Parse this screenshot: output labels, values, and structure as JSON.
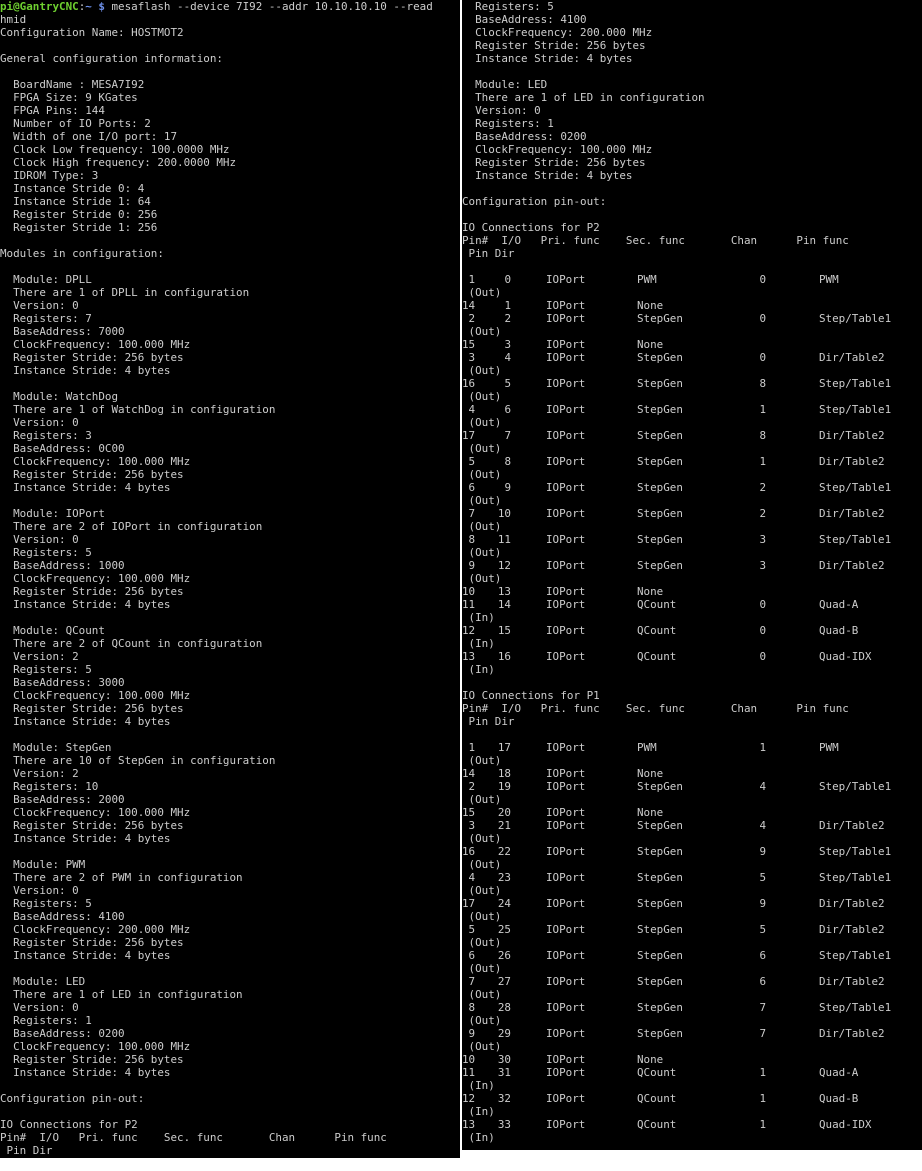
{
  "terminal": {
    "prompt_user": "pi@GantryCNC",
    "prompt_sep": ":",
    "prompt_path": "~ $",
    "command": " mesaflash --device 7I92 --addr 10.10.10.10 --read",
    "command_wrap": "hmid"
  },
  "left_lines": [
    "Configuration Name: HOSTMOT2",
    "",
    "General configuration information:",
    "",
    "  BoardName : MESA7I92",
    "  FPGA Size: 9 KGates",
    "  FPGA Pins: 144",
    "  Number of IO Ports: 2",
    "  Width of one I/O port: 17",
    "  Clock Low frequency: 100.0000 MHz",
    "  Clock High frequency: 200.0000 MHz",
    "  IDROM Type: 3",
    "  Instance Stride 0: 4",
    "  Instance Stride 1: 64",
    "  Register Stride 0: 256",
    "  Register Stride 1: 256",
    "",
    "Modules in configuration:",
    "",
    "  Module: DPLL",
    "  There are 1 of DPLL in configuration",
    "  Version: 0",
    "  Registers: 7",
    "  BaseAddress: 7000",
    "  ClockFrequency: 100.000 MHz",
    "  Register Stride: 256 bytes",
    "  Instance Stride: 4 bytes",
    "",
    "  Module: WatchDog",
    "  There are 1 of WatchDog in configuration",
    "  Version: 0",
    "  Registers: 3",
    "  BaseAddress: 0C00",
    "  ClockFrequency: 100.000 MHz",
    "  Register Stride: 256 bytes",
    "  Instance Stride: 4 bytes",
    "",
    "  Module: IOPort",
    "  There are 2 of IOPort in configuration",
    "  Version: 0",
    "  Registers: 5",
    "  BaseAddress: 1000",
    "  ClockFrequency: 100.000 MHz",
    "  Register Stride: 256 bytes",
    "  Instance Stride: 4 bytes",
    "",
    "  Module: QCount",
    "  There are 2 of QCount in configuration",
    "  Version: 2",
    "  Registers: 5",
    "  BaseAddress: 3000",
    "  ClockFrequency: 100.000 MHz",
    "  Register Stride: 256 bytes",
    "  Instance Stride: 4 bytes",
    "",
    "  Module: StepGen",
    "  There are 10 of StepGen in configuration",
    "  Version: 2",
    "  Registers: 10",
    "  BaseAddress: 2000",
    "  ClockFrequency: 100.000 MHz",
    "  Register Stride: 256 bytes",
    "  Instance Stride: 4 bytes",
    "",
    "  Module: PWM",
    "  There are 2 of PWM in configuration",
    "  Version: 0",
    "  Registers: 5",
    "  BaseAddress: 4100",
    "  ClockFrequency: 200.000 MHz",
    "  Register Stride: 256 bytes",
    "  Instance Stride: 4 bytes",
    "",
    "  Module: LED",
    "  There are 1 of LED in configuration",
    "  Version: 0",
    "  Registers: 1",
    "  BaseAddress: 0200",
    "  ClockFrequency: 100.000 MHz",
    "  Register Stride: 256 bytes",
    "  Instance Stride: 4 bytes",
    "",
    "Configuration pin-out:",
    "",
    "IO Connections for P2",
    "Pin#  I/O   Pri. func    Sec. func       Chan      Pin func",
    " Pin Dir"
  ],
  "right_top_lines": [
    "  Registers: 5",
    "  BaseAddress: 4100",
    "  ClockFrequency: 200.000 MHz",
    "  Register Stride: 256 bytes",
    "  Instance Stride: 4 bytes",
    "",
    "  Module: LED",
    "  There are 1 of LED in configuration",
    "  Version: 0",
    "  Registers: 1",
    "  BaseAddress: 0200",
    "  ClockFrequency: 100.000 MHz",
    "  Register Stride: 256 bytes",
    "  Instance Stride: 4 bytes",
    "",
    "Configuration pin-out:",
    ""
  ],
  "connections": [
    {
      "title": "IO Connections for P2",
      "header": "Pin#  I/O   Pri. func    Sec. func       Chan      Pin func",
      "header2": " Pin Dir",
      "rows": [
        {
          "pin": " 1",
          "io": "0",
          "pri": "IOPort",
          "sec": "PWM",
          "chan": "0",
          "func": "PWM",
          "dir": " (Out)"
        },
        {
          "pin": "14",
          "io": "1",
          "pri": "IOPort",
          "sec": "None",
          "chan": "",
          "func": "",
          "dir": ""
        },
        {
          "pin": " 2",
          "io": "2",
          "pri": "IOPort",
          "sec": "StepGen",
          "chan": "0",
          "func": "Step/Table1",
          "dir": " (Out)"
        },
        {
          "pin": "15",
          "io": "3",
          "pri": "IOPort",
          "sec": "None",
          "chan": "",
          "func": "",
          "dir": ""
        },
        {
          "pin": " 3",
          "io": "4",
          "pri": "IOPort",
          "sec": "StepGen",
          "chan": "0",
          "func": "Dir/Table2",
          "dir": " (Out)"
        },
        {
          "pin": "16",
          "io": "5",
          "pri": "IOPort",
          "sec": "StepGen",
          "chan": "8",
          "func": "Step/Table1",
          "dir": " (Out)"
        },
        {
          "pin": " 4",
          "io": "6",
          "pri": "IOPort",
          "sec": "StepGen",
          "chan": "1",
          "func": "Step/Table1",
          "dir": " (Out)"
        },
        {
          "pin": "17",
          "io": "7",
          "pri": "IOPort",
          "sec": "StepGen",
          "chan": "8",
          "func": "Dir/Table2",
          "dir": " (Out)"
        },
        {
          "pin": " 5",
          "io": "8",
          "pri": "IOPort",
          "sec": "StepGen",
          "chan": "1",
          "func": "Dir/Table2",
          "dir": " (Out)"
        },
        {
          "pin": " 6",
          "io": "9",
          "pri": "IOPort",
          "sec": "StepGen",
          "chan": "2",
          "func": "Step/Table1",
          "dir": " (Out)"
        },
        {
          "pin": " 7",
          "io": "10",
          "pri": "IOPort",
          "sec": "StepGen",
          "chan": "2",
          "func": "Dir/Table2",
          "dir": " (Out)"
        },
        {
          "pin": " 8",
          "io": "11",
          "pri": "IOPort",
          "sec": "StepGen",
          "chan": "3",
          "func": "Step/Table1",
          "dir": " (Out)"
        },
        {
          "pin": " 9",
          "io": "12",
          "pri": "IOPort",
          "sec": "StepGen",
          "chan": "3",
          "func": "Dir/Table2",
          "dir": " (Out)"
        },
        {
          "pin": "10",
          "io": "13",
          "pri": "IOPort",
          "sec": "None",
          "chan": "",
          "func": "",
          "dir": ""
        },
        {
          "pin": "11",
          "io": "14",
          "pri": "IOPort",
          "sec": "QCount",
          "chan": "0",
          "func": "Quad-A",
          "dir": " (In)"
        },
        {
          "pin": "12",
          "io": "15",
          "pri": "IOPort",
          "sec": "QCount",
          "chan": "0",
          "func": "Quad-B",
          "dir": " (In)"
        },
        {
          "pin": "13",
          "io": "16",
          "pri": "IOPort",
          "sec": "QCount",
          "chan": "0",
          "func": "Quad-IDX",
          "dir": " (In)"
        }
      ]
    },
    {
      "title": "IO Connections for P1",
      "header": "Pin#  I/O   Pri. func    Sec. func       Chan      Pin func",
      "header2": " Pin Dir",
      "rows": [
        {
          "pin": " 1",
          "io": "17",
          "pri": "IOPort",
          "sec": "PWM",
          "chan": "1",
          "func": "PWM",
          "dir": " (Out)"
        },
        {
          "pin": "14",
          "io": "18",
          "pri": "IOPort",
          "sec": "None",
          "chan": "",
          "func": "",
          "dir": ""
        },
        {
          "pin": " 2",
          "io": "19",
          "pri": "IOPort",
          "sec": "StepGen",
          "chan": "4",
          "func": "Step/Table1",
          "dir": " (Out)"
        },
        {
          "pin": "15",
          "io": "20",
          "pri": "IOPort",
          "sec": "None",
          "chan": "",
          "func": "",
          "dir": ""
        },
        {
          "pin": " 3",
          "io": "21",
          "pri": "IOPort",
          "sec": "StepGen",
          "chan": "4",
          "func": "Dir/Table2",
          "dir": " (Out)"
        },
        {
          "pin": "16",
          "io": "22",
          "pri": "IOPort",
          "sec": "StepGen",
          "chan": "9",
          "func": "Step/Table1",
          "dir": " (Out)"
        },
        {
          "pin": " 4",
          "io": "23",
          "pri": "IOPort",
          "sec": "StepGen",
          "chan": "5",
          "func": "Step/Table1",
          "dir": " (Out)"
        },
        {
          "pin": "17",
          "io": "24",
          "pri": "IOPort",
          "sec": "StepGen",
          "chan": "9",
          "func": "Dir/Table2",
          "dir": " (Out)"
        },
        {
          "pin": " 5",
          "io": "25",
          "pri": "IOPort",
          "sec": "StepGen",
          "chan": "5",
          "func": "Dir/Table2",
          "dir": " (Out)"
        },
        {
          "pin": " 6",
          "io": "26",
          "pri": "IOPort",
          "sec": "StepGen",
          "chan": "6",
          "func": "Step/Table1",
          "dir": " (Out)"
        },
        {
          "pin": " 7",
          "io": "27",
          "pri": "IOPort",
          "sec": "StepGen",
          "chan": "6",
          "func": "Dir/Table2",
          "dir": " (Out)"
        },
        {
          "pin": " 8",
          "io": "28",
          "pri": "IOPort",
          "sec": "StepGen",
          "chan": "7",
          "func": "Step/Table1",
          "dir": " (Out)"
        },
        {
          "pin": " 9",
          "io": "29",
          "pri": "IOPort",
          "sec": "StepGen",
          "chan": "7",
          "func": "Dir/Table2",
          "dir": " (Out)"
        },
        {
          "pin": "10",
          "io": "30",
          "pri": "IOPort",
          "sec": "None",
          "chan": "",
          "func": "",
          "dir": ""
        },
        {
          "pin": "11",
          "io": "31",
          "pri": "IOPort",
          "sec": "QCount",
          "chan": "1",
          "func": "Quad-A",
          "dir": " (In)"
        },
        {
          "pin": "12",
          "io": "32",
          "pri": "IOPort",
          "sec": "QCount",
          "chan": "1",
          "func": "Quad-B",
          "dir": " (In)"
        },
        {
          "pin": "13",
          "io": "33",
          "pri": "IOPort",
          "sec": "QCount",
          "chan": "1",
          "func": "Quad-IDX",
          "dir": " (In)"
        }
      ]
    }
  ]
}
